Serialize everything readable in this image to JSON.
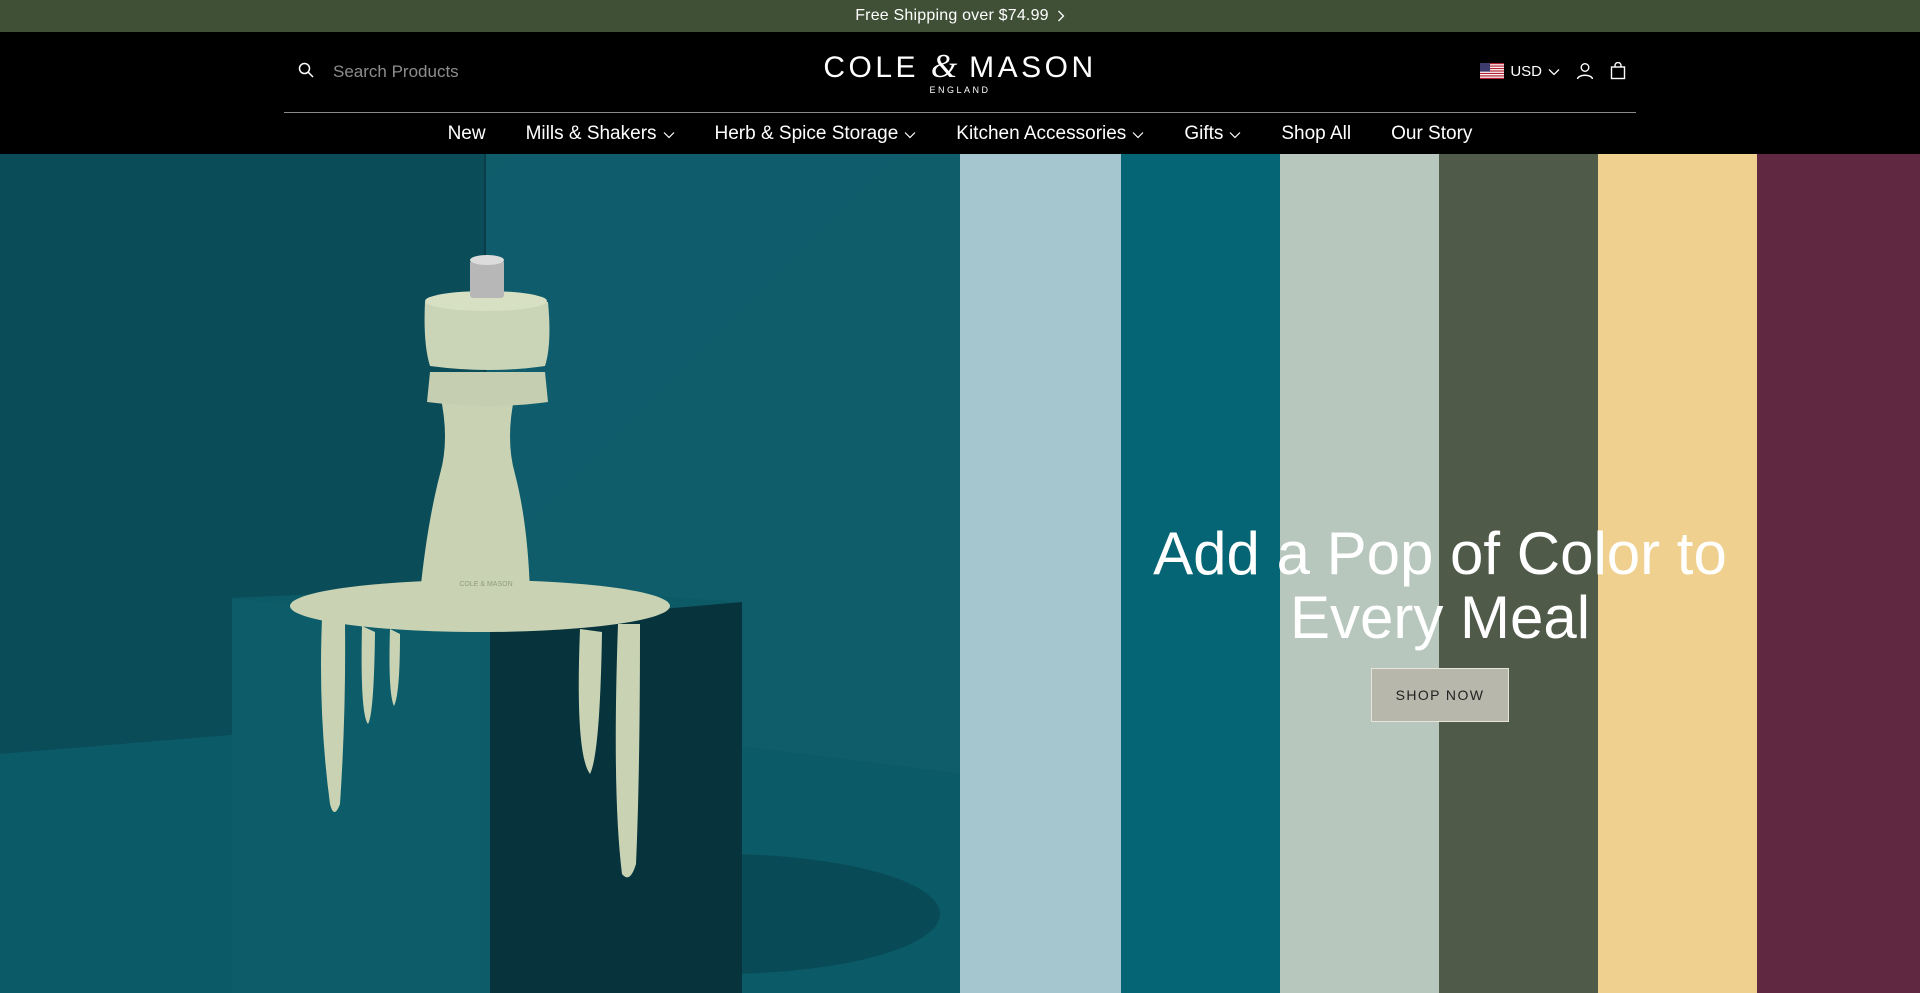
{
  "announcement": {
    "text": "Free Shipping over $74.99"
  },
  "header": {
    "search_placeholder": "Search Products",
    "logo": {
      "main_left": "COLE",
      "amp": "&",
      "main_right": "MASON",
      "sub": "ENGLAND"
    },
    "currency": "USD"
  },
  "nav": {
    "items": [
      {
        "label": "New"
      },
      {
        "label": "Mills & Shakers"
      },
      {
        "label": "Herb & Spice Storage"
      },
      {
        "label": "Kitchen Accessories"
      },
      {
        "label": "Gifts"
      },
      {
        "label": "Shop All"
      },
      {
        "label": "Our Story"
      }
    ]
  },
  "hero": {
    "title": "Add a Pop of Color to Every Meal",
    "button": "SHOP NOW",
    "stripe_colors": [
      "#a6c6cf",
      "#066574",
      "#b8c7be",
      "#4f5a49",
      "#f0d08e",
      "#602841"
    ],
    "product": {
      "logo_text": "COLE & MASON"
    }
  },
  "colors": {
    "announcement_bg": "#3f5036",
    "header_bg": "#000000",
    "teal": "#0f5866",
    "cream": "#c9d3b4"
  }
}
